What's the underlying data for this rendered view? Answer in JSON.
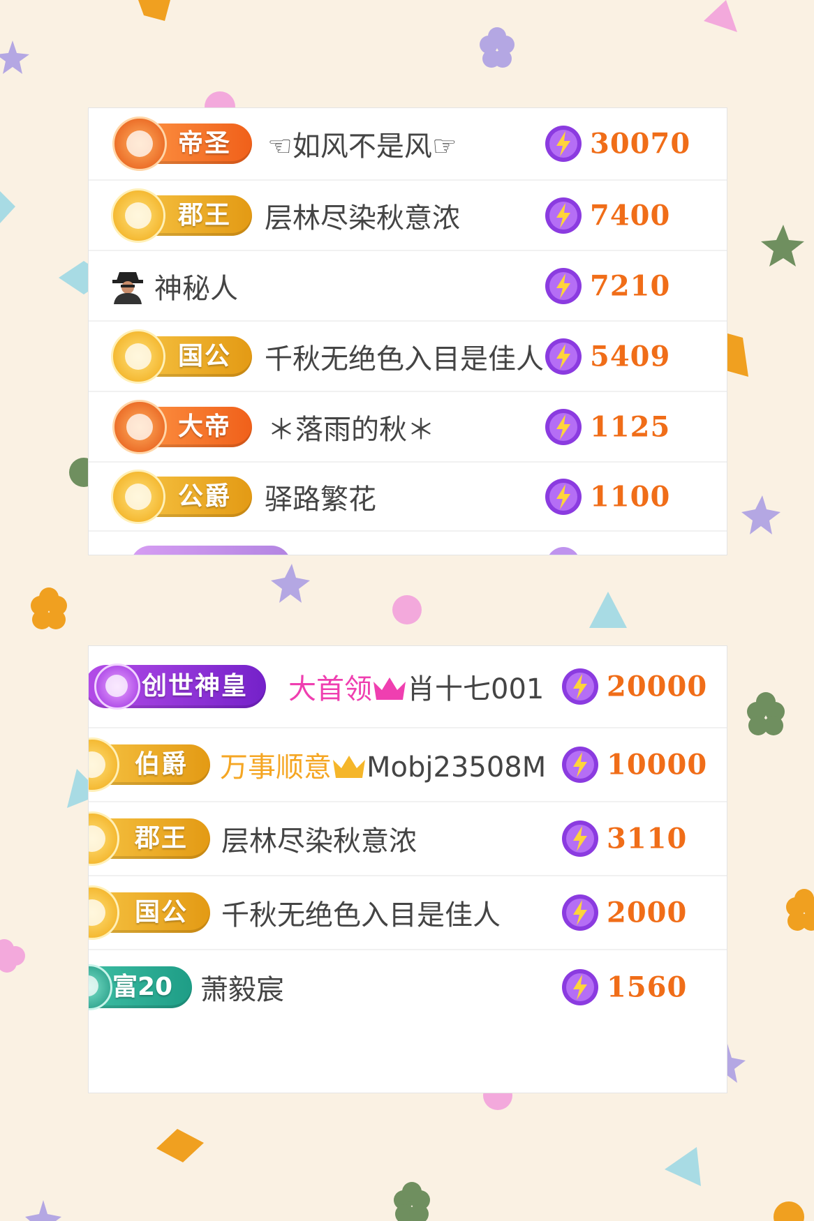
{
  "colors": {
    "background": "#faf1e3",
    "value_orange": "#f06d18",
    "title_pink": "#ef3fb0",
    "title_orange": "#f5a623",
    "name_gray": "#444444"
  },
  "top_list": {
    "rows": [
      {
        "badge": "帝圣",
        "badge_style": "orange",
        "name": "☜如风不是风☞",
        "value": "30070"
      },
      {
        "badge": "郡王",
        "badge_style": "gold",
        "name": "层林尽染秋意浓",
        "value": "7400"
      },
      {
        "badge": "",
        "badge_style": "anonymous",
        "name": "神秘人",
        "value": "7210"
      },
      {
        "badge": "国公",
        "badge_style": "gold",
        "name": "千秋无绝色入目是佳人",
        "value": "5409"
      },
      {
        "badge": "大帝",
        "badge_style": "orange",
        "name": "＊落雨的秋＊",
        "value": "1125"
      },
      {
        "badge": "公爵",
        "badge_style": "gold",
        "name": "驿路繁花",
        "value": "1100"
      }
    ]
  },
  "bottom_list": {
    "rows": [
      {
        "badge": "创世神皇",
        "badge_style": "purple",
        "title": "大首领",
        "title_icon": "pink-crown-icon",
        "name": "肖十七001",
        "value": "20000"
      },
      {
        "badge": "伯爵",
        "badge_style": "gold",
        "title": "万事顺意",
        "title_icon": "gold-crown-icon",
        "name": "Mobj23508M",
        "value": "10000"
      },
      {
        "badge": "郡王",
        "badge_style": "gold",
        "name": "层林尽染秋意浓",
        "value": "3110"
      },
      {
        "badge": "国公",
        "badge_style": "gold",
        "name": "千秋无绝色入目是佳人",
        "value": "2000"
      },
      {
        "badge": "富20",
        "badge_style": "teal",
        "name": "萧毅宸",
        "value": "1560"
      }
    ]
  },
  "icons": {
    "value_icon": "lightning-coin-icon",
    "anonymous_icon": "masked-person-icon"
  }
}
